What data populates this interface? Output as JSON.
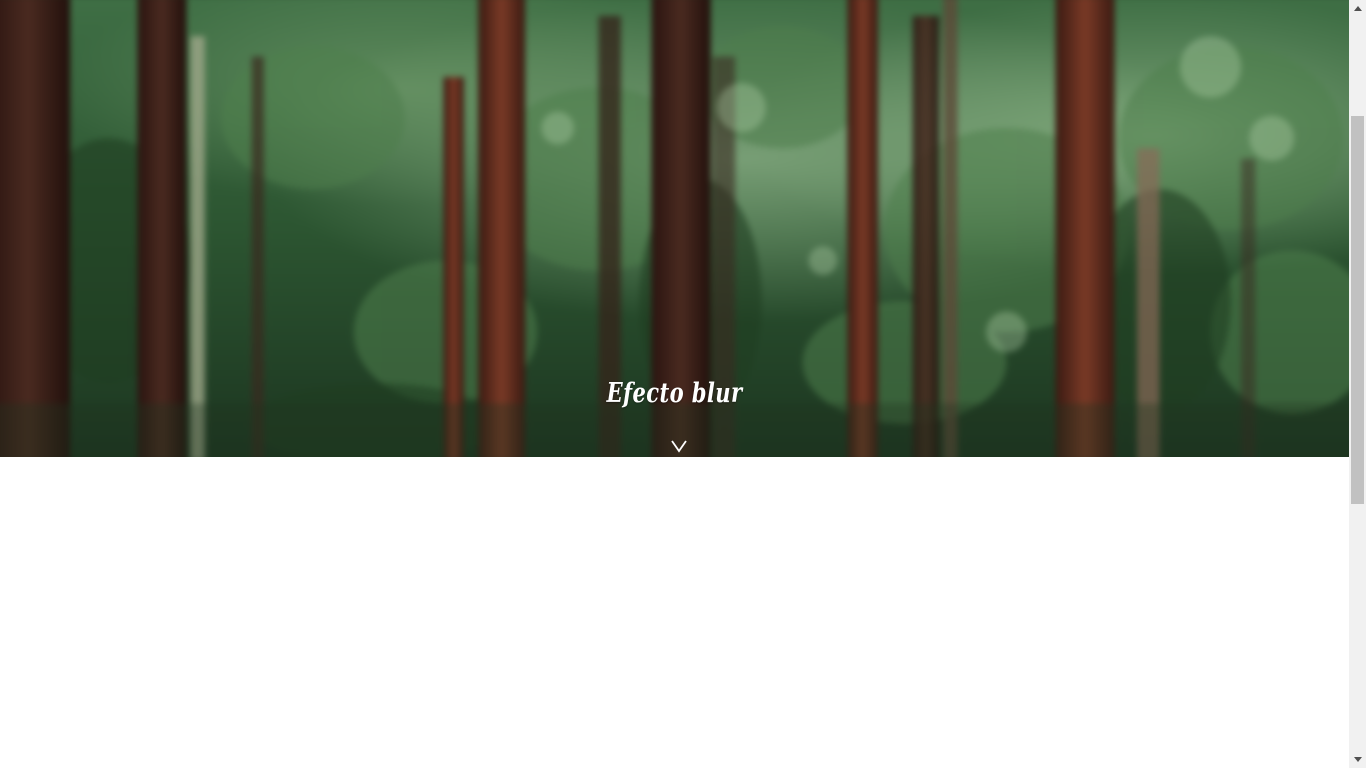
{
  "hero": {
    "title": "Efecto blur",
    "background_image": "blurred-forest-photo",
    "scroll_icon": "chevron-down-icon"
  },
  "scrollbar": {
    "up_icon": "arrow-up-icon",
    "down_icon": "arrow-down-icon",
    "scroll_position": 0.15
  },
  "colors": {
    "title_text": "#ffffff",
    "page_background": "#ffffff",
    "forest_dark": "#1f3a22",
    "scrollbar_track": "#f1f1f1",
    "scrollbar_thumb": "#c1c1c1"
  }
}
